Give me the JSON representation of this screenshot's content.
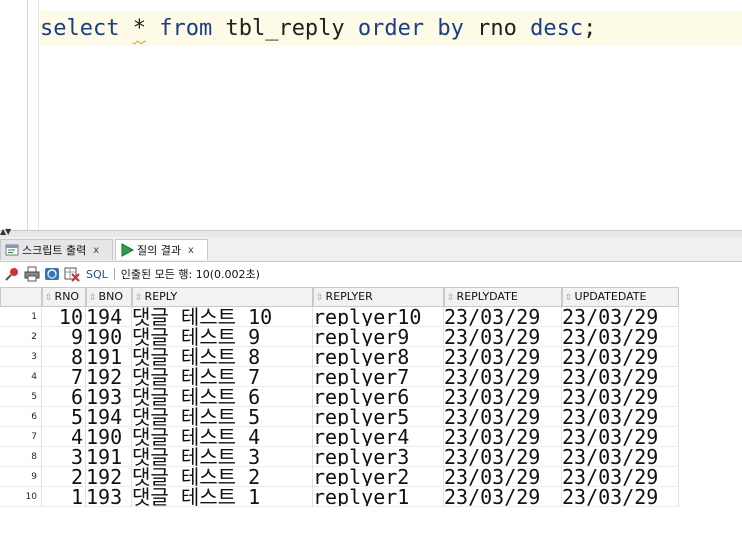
{
  "editor": {
    "tokens": [
      {
        "text": "select",
        "kind": "kw"
      },
      {
        "text": " ",
        "kind": "plain"
      },
      {
        "text": "*",
        "kind": "star"
      },
      {
        "text": " ",
        "kind": "plain"
      },
      {
        "text": "from",
        "kind": "kw"
      },
      {
        "text": " tbl_reply ",
        "kind": "plain"
      },
      {
        "text": "order",
        "kind": "kw"
      },
      {
        "text": " ",
        "kind": "plain"
      },
      {
        "text": "by",
        "kind": "kw"
      },
      {
        "text": " rno ",
        "kind": "plain"
      },
      {
        "text": "desc",
        "kind": "kw"
      },
      {
        "text": ";",
        "kind": "plain"
      }
    ]
  },
  "tabs": [
    {
      "label": "스크립트 출력",
      "close": "x"
    },
    {
      "label": "질의 결과",
      "close": "x"
    }
  ],
  "toolbar": {
    "sql_label": "SQL",
    "status": "인출된 모든 행: 10(0.002초)"
  },
  "grid": {
    "columns": [
      "RNO",
      "BNO",
      "REPLY",
      "REPLYER",
      "REPLYDATE",
      "UPDATEDATE"
    ],
    "rows": [
      {
        "n": "1",
        "rno": "10",
        "bno": "194",
        "reply": "댓글 테스트 10",
        "replyer": "replyer10",
        "replydate": "23/03/29",
        "updatedate": "23/03/29"
      },
      {
        "n": "2",
        "rno": "9",
        "bno": "190",
        "reply": "댓글 테스트 9",
        "replyer": "replyer9",
        "replydate": "23/03/29",
        "updatedate": "23/03/29"
      },
      {
        "n": "3",
        "rno": "8",
        "bno": "191",
        "reply": "댓글 테스트 8",
        "replyer": "replyer8",
        "replydate": "23/03/29",
        "updatedate": "23/03/29"
      },
      {
        "n": "4",
        "rno": "7",
        "bno": "192",
        "reply": "댓글 테스트 7",
        "replyer": "replyer7",
        "replydate": "23/03/29",
        "updatedate": "23/03/29"
      },
      {
        "n": "5",
        "rno": "6",
        "bno": "193",
        "reply": "댓글 테스트 6",
        "replyer": "replyer6",
        "replydate": "23/03/29",
        "updatedate": "23/03/29"
      },
      {
        "n": "6",
        "rno": "5",
        "bno": "194",
        "reply": "댓글 테스트 5",
        "replyer": "replyer5",
        "replydate": "23/03/29",
        "updatedate": "23/03/29"
      },
      {
        "n": "7",
        "rno": "4",
        "bno": "190",
        "reply": "댓글 테스트 4",
        "replyer": "replyer4",
        "replydate": "23/03/29",
        "updatedate": "23/03/29"
      },
      {
        "n": "8",
        "rno": "3",
        "bno": "191",
        "reply": "댓글 테스트 3",
        "replyer": "replyer3",
        "replydate": "23/03/29",
        "updatedate": "23/03/29"
      },
      {
        "n": "9",
        "rno": "2",
        "bno": "192",
        "reply": "댓글 테스트 2",
        "replyer": "replyer2",
        "replydate": "23/03/29",
        "updatedate": "23/03/29"
      },
      {
        "n": "10",
        "rno": "1",
        "bno": "193",
        "reply": "댓글 테스트 1",
        "replyer": "replyer1",
        "replydate": "23/03/29",
        "updatedate": "23/03/29"
      }
    ]
  }
}
